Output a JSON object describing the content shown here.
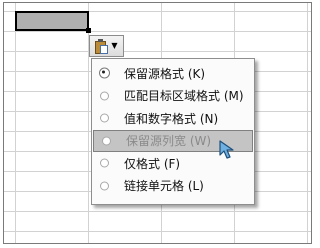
{
  "paste_options": {
    "button_icon": "clipboard-icon",
    "dropdown_icon": "chevron-down-icon",
    "items": [
      {
        "label": "保留源格式 (K)",
        "selected": true
      },
      {
        "label": "匹配目标区域格式 (M)",
        "selected": false
      },
      {
        "label": "值和数字格式 (N)",
        "selected": false
      },
      {
        "label": "保留源列宽 (W)",
        "selected": false,
        "highlighted": true
      },
      {
        "label": "仅格式 (F)",
        "selected": false
      },
      {
        "label": "链接单元格 (L)",
        "selected": false
      }
    ]
  },
  "colors": {
    "selected_cell": "#b0b0b0",
    "highlight": "#c4c4c4"
  }
}
